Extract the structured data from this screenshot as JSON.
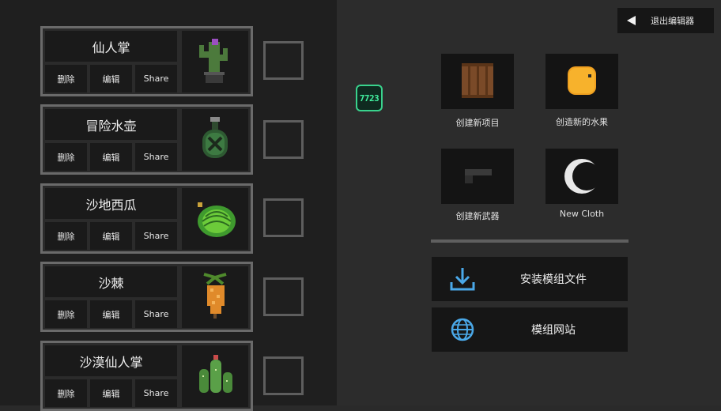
{
  "items": [
    {
      "name": "仙人掌",
      "delete": "删除",
      "edit": "编辑",
      "share": "Share",
      "icon": "cactus-icon"
    },
    {
      "name": "冒险水壶",
      "delete": "删除",
      "edit": "编辑",
      "share": "Share",
      "icon": "flask-icon"
    },
    {
      "name": "沙地西瓜",
      "delete": "删除",
      "edit": "编辑",
      "share": "Share",
      "icon": "watermelon-icon"
    },
    {
      "name": "沙棘",
      "delete": "删除",
      "edit": "编辑",
      "share": "Share",
      "icon": "sea-buckthorn-icon"
    },
    {
      "name": "沙漠仙人掌",
      "delete": "删除",
      "edit": "编辑",
      "share": "Share",
      "icon": "desert-cactus-icon"
    }
  ],
  "exit": {
    "label": "退出编辑器"
  },
  "badge": {
    "text": "7723"
  },
  "create": [
    {
      "label": "创建新项目",
      "icon": "wooden-crate-icon"
    },
    {
      "label": "创造新的水果",
      "icon": "orange-fruit-icon"
    },
    {
      "label": "创建新武器",
      "icon": "gun-icon"
    },
    {
      "label": "New Cloth",
      "icon": "moon-cloth-icon"
    }
  ],
  "actions": {
    "install": {
      "label": "安装模组文件",
      "icon": "download-icon"
    },
    "website": {
      "label": "模组网站",
      "icon": "globe-icon"
    }
  },
  "colors": {
    "accent_blue": "#4aa8e8",
    "badge_green": "#39d38d"
  }
}
